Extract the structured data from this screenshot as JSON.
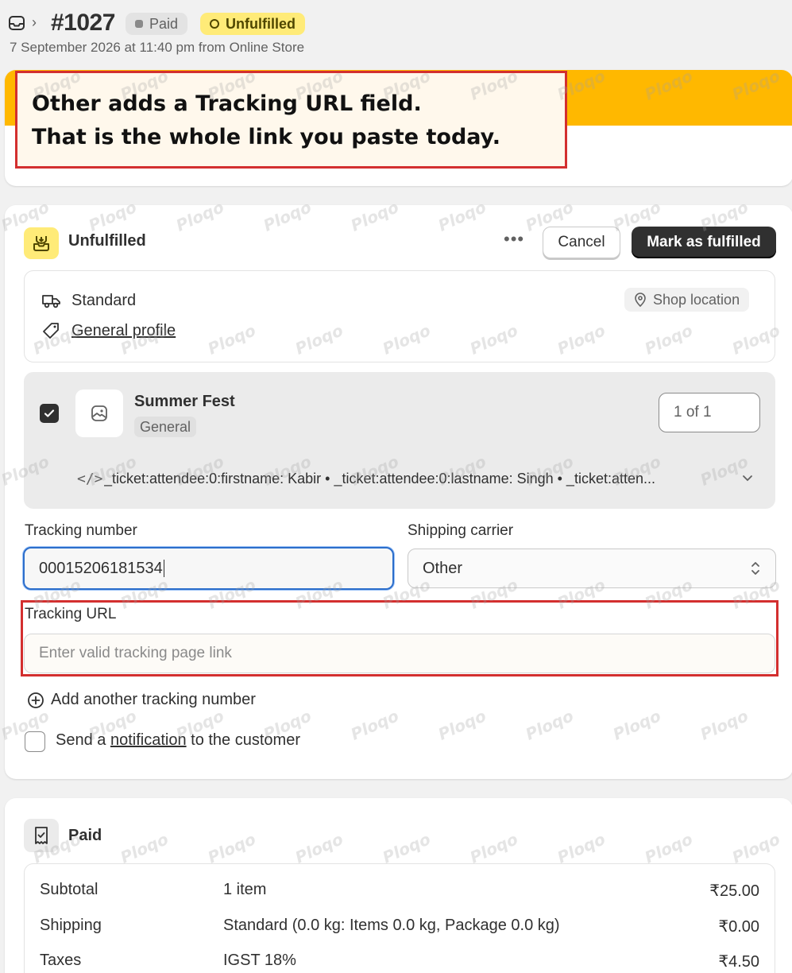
{
  "header": {
    "order_number": "#1027",
    "paid_badge": "Paid",
    "unfulfilled_badge": "Unfulfilled",
    "subtitle": "7 September 2026 at 11:40 pm from Online Store"
  },
  "callout": {
    "line1": "Other adds a Tracking URL field.",
    "line2": "That is the whole link you paste today."
  },
  "fulfillment": {
    "title": "Unfulfilled",
    "more_label": "•••",
    "cancel_label": "Cancel",
    "mark_label": "Mark as fulfilled",
    "shipping_method": "Standard",
    "profile_link": "General profile",
    "shop_location": "Shop location",
    "item": {
      "name": "Summer Fest",
      "variant": "General",
      "quantity": "1 of 1",
      "properties": "_ticket:attendee:0:firstname: Kabir • _ticket:attendee:0:lastname: Singh • _ticket:atten..."
    },
    "tracking_number_label": "Tracking number",
    "tracking_number_value": "00015206181534",
    "carrier_label": "Shipping carrier",
    "carrier_value": "Other",
    "tracking_url_label": "Tracking URL",
    "tracking_url_placeholder": "Enter valid tracking page link",
    "add_tracking": "Add another tracking number",
    "notify_prefix": "Send a ",
    "notify_link": "notification",
    "notify_suffix": " to the customer"
  },
  "payment": {
    "title": "Paid",
    "rows": [
      {
        "label": "Subtotal",
        "detail": "1 item",
        "amount": "₹25.00"
      },
      {
        "label": "Shipping",
        "detail": "Standard (0.0 kg: Items 0.0 kg, Package 0.0 kg)",
        "amount": "₹0.00"
      },
      {
        "label": "Taxes",
        "detail": "IGST 18%",
        "amount": "₹4.50"
      }
    ]
  },
  "watermark": "Ploqo",
  "colors": {
    "accent_banner": "#ffb800",
    "unfulfilled_badge": "#ffeb78",
    "callout_border": "#d32f2f",
    "primary_button": "#303030",
    "focus_ring": "#2c6ecb"
  },
  "icons": {
    "order": "inbox-icon",
    "unfulfilled": "package-icon",
    "shipping": "truck-icon",
    "profile": "tag-icon",
    "location": "location-pin-icon",
    "image": "image-placeholder-icon",
    "code": "code-icon",
    "select": "select-arrows-icon",
    "add": "plus-circle-icon",
    "paid": "receipt-icon"
  }
}
